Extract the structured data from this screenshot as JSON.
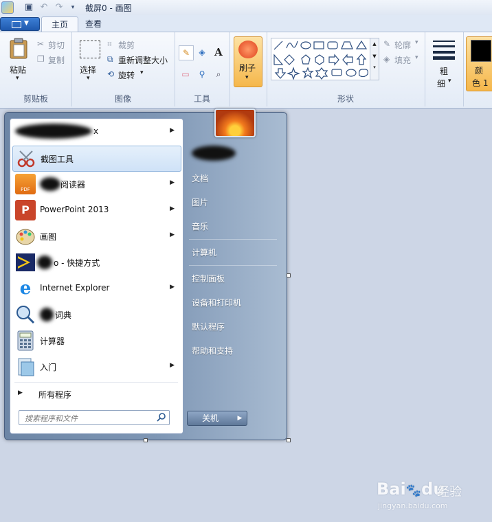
{
  "window": {
    "title": "截屏0 - 画图"
  },
  "ribbon": {
    "tabs": [
      {
        "label": "主页"
      },
      {
        "label": "查看"
      }
    ],
    "clipboard": {
      "paste": "粘贴",
      "cut": "剪切",
      "copy": "复制",
      "label": "剪贴板"
    },
    "image": {
      "select": "选择",
      "crop": "裁剪",
      "resize": "重新调整大小",
      "rotate": "旋转",
      "label": "图像"
    },
    "tools": {
      "label": "工具",
      "text_tool": "A"
    },
    "brush": {
      "label": "刷子"
    },
    "shapes": {
      "outline": "轮廓",
      "fill": "填充",
      "label": "形状"
    },
    "size": {
      "label": "粗\n细",
      "line1": "粗",
      "line2": "细"
    },
    "color": {
      "line1": "颜",
      "line2": "色 1",
      "swatch": "#000000",
      "accent": "#f9c150"
    }
  },
  "start_menu": {
    "programs": [
      {
        "label": "x",
        "has_arrow": true
      },
      {
        "label": "截图工具",
        "has_arrow": false
      },
      {
        "label": "阅读器",
        "has_arrow": true
      },
      {
        "label": "PowerPoint 2013",
        "has_arrow": true
      },
      {
        "label": "画图",
        "has_arrow": true
      },
      {
        "label": "o - 快捷方式",
        "has_arrow": false
      },
      {
        "label": "Internet Explorer",
        "has_arrow": true
      },
      {
        "label": "词典",
        "has_arrow": false
      },
      {
        "label": "计算器",
        "has_arrow": false
      },
      {
        "label": "入门",
        "has_arrow": true
      }
    ],
    "all_programs": "所有程序",
    "search_placeholder": "搜索程序和文件",
    "right_items": [
      {
        "label": "文档"
      },
      {
        "label": "图片"
      },
      {
        "label": "音乐"
      },
      {
        "label": "计算机"
      },
      {
        "label": "控制面板"
      },
      {
        "label": "设备和打印机"
      },
      {
        "label": "默认程序"
      },
      {
        "label": "帮助和支持"
      }
    ],
    "shutdown": "关机"
  },
  "watermark": {
    "brand": "Bai",
    "brand2": "du",
    "cn": "经验",
    "url": "jingyan.baidu.com"
  }
}
